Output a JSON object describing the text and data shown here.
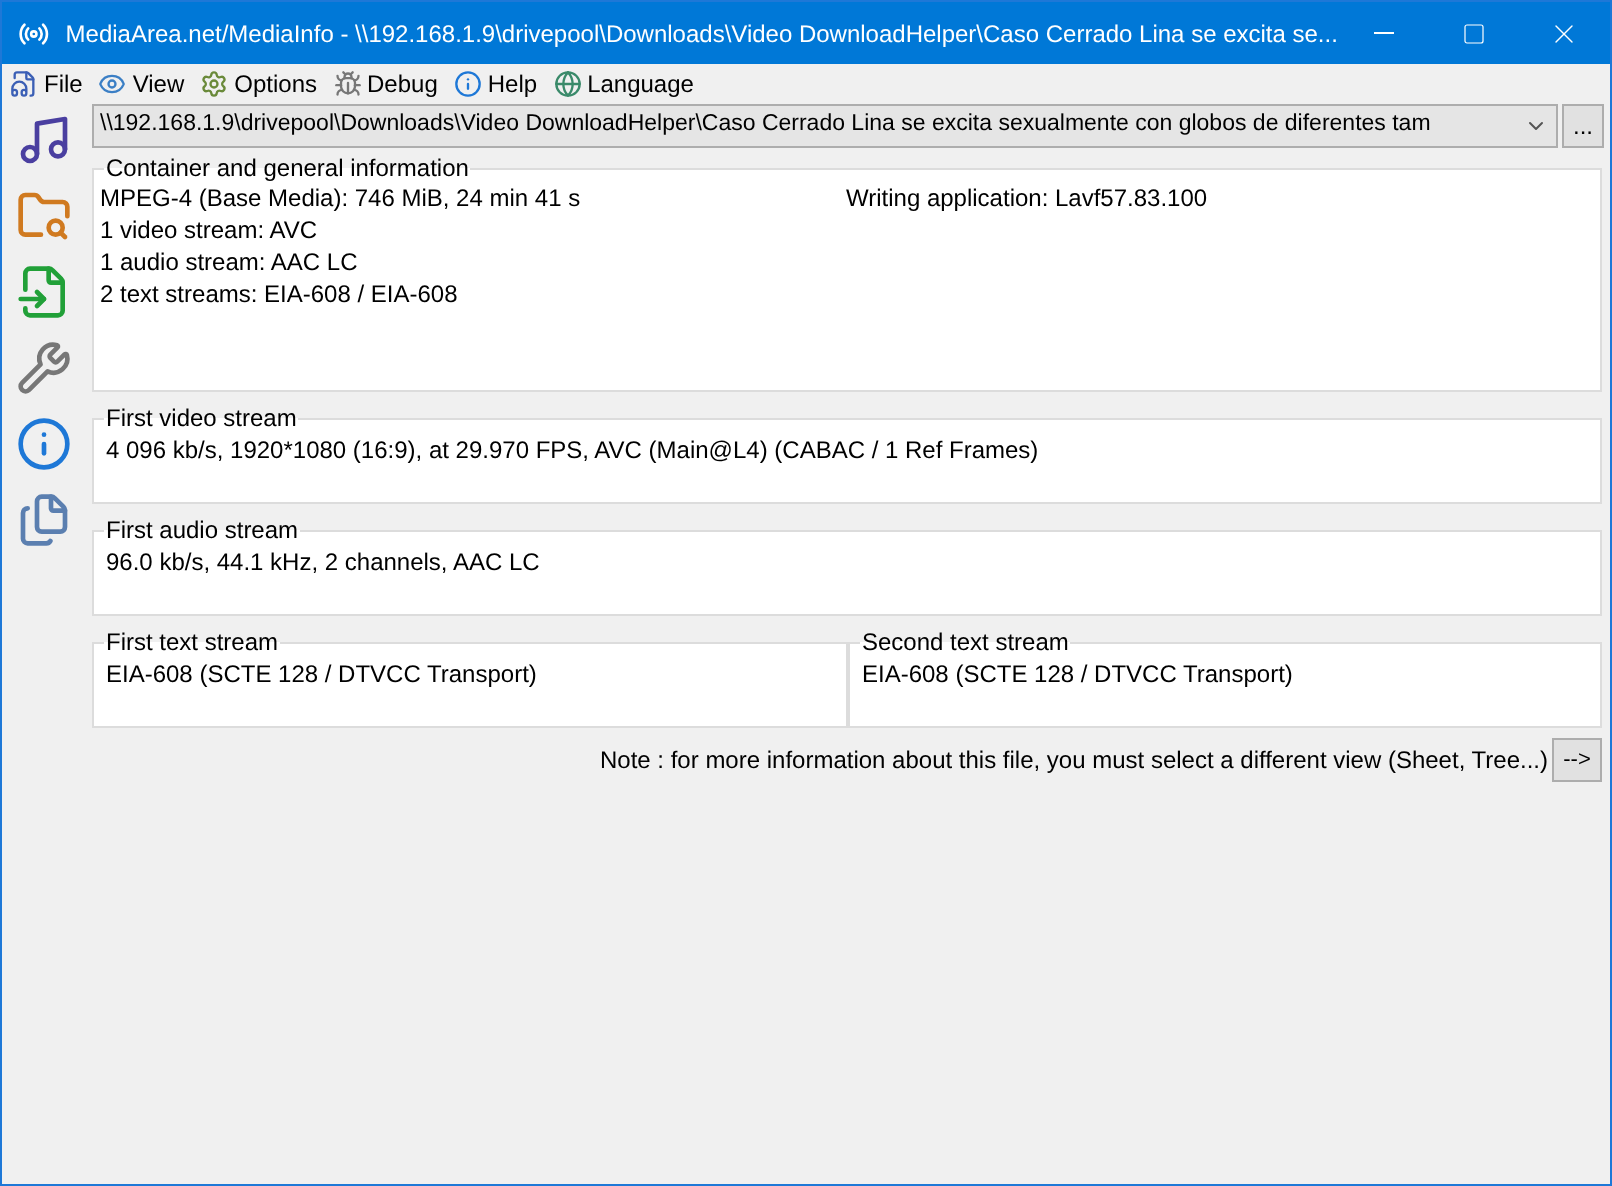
{
  "window": {
    "title": "MediaArea.net/MediaInfo - \\\\192.168.1.9\\drivepool\\Downloads\\Video DownloadHelper\\Caso Cerrado Lina se excita se..."
  },
  "menu": [
    "File",
    "View",
    "Options",
    "Debug",
    "Help",
    "Language"
  ],
  "file_path": {
    "value": "\\\\192.168.1.9\\drivepool\\Downloads\\Video DownloadHelper\\Caso Cerrado Lina se excita sexualmente con globos de diferentes tam",
    "browse": "..."
  },
  "general": {
    "title": "Container and general information",
    "lines": [
      {
        "text": "MPEG-4 (Base Media): 746 MiB, 24 min 41 s",
        "extra": "Writing application: Lavf57.83.100"
      },
      {
        "text": "1 video stream: AVC"
      },
      {
        "text": "1 audio stream: AAC LC"
      },
      {
        "text": "2 text streams: EIA-608 / EIA-608"
      }
    ]
  },
  "streams": [
    {
      "title": "First video stream",
      "text": "4 096 kb/s, 1920*1080 (16:9), at 29.970 FPS, AVC (Main@L4) (CABAC / 1 Ref Frames)"
    },
    {
      "title": "First audio stream",
      "text": "96.0 kb/s, 44.1 kHz, 2 channels, AAC LC"
    }
  ],
  "text_streams": [
    {
      "title": "First text stream",
      "text": "EIA-608 (SCTE 128 / DTVCC Transport)"
    },
    {
      "title": "Second text stream",
      "text": "EIA-608 (SCTE 128 / DTVCC Transport)"
    }
  ],
  "note": {
    "text": "Note : for more information about this file, you must select a different view (Sheet, Tree...)",
    "button": "-->"
  }
}
